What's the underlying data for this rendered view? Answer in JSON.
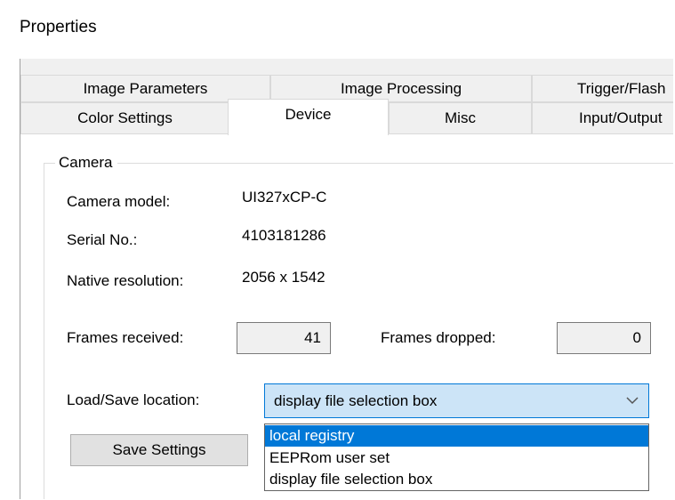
{
  "window": {
    "title": "Properties"
  },
  "tabs_row1": [
    {
      "label": "Image Parameters"
    },
    {
      "label": "Image Processing"
    },
    {
      "label": "Trigger/Flash"
    }
  ],
  "tabs_row2": [
    {
      "label": "Color Settings"
    },
    {
      "label": "Device",
      "active": true
    },
    {
      "label": "Misc"
    },
    {
      "label": "Input/Output"
    }
  ],
  "camera_group": {
    "title": "Camera",
    "model_label": "Camera model:",
    "model_value": "UI327xCP-C",
    "serial_label": "Serial No.:",
    "serial_value": "4103181286",
    "resolution_label": "Native resolution:",
    "resolution_value": "2056 x 1542",
    "frames_received_label": "Frames received:",
    "frames_received_value": "41",
    "frames_dropped_label": "Frames dropped:",
    "frames_dropped_value": "0",
    "load_save_label": "Load/Save location:",
    "load_save_selected": "display file selection box",
    "load_save_options": [
      "local registry",
      "EEPRom user set",
      "display file selection box"
    ],
    "save_button": "Save Settings"
  },
  "colors": {
    "accent": "#0078d7",
    "combo_bg": "#cce4f7"
  }
}
